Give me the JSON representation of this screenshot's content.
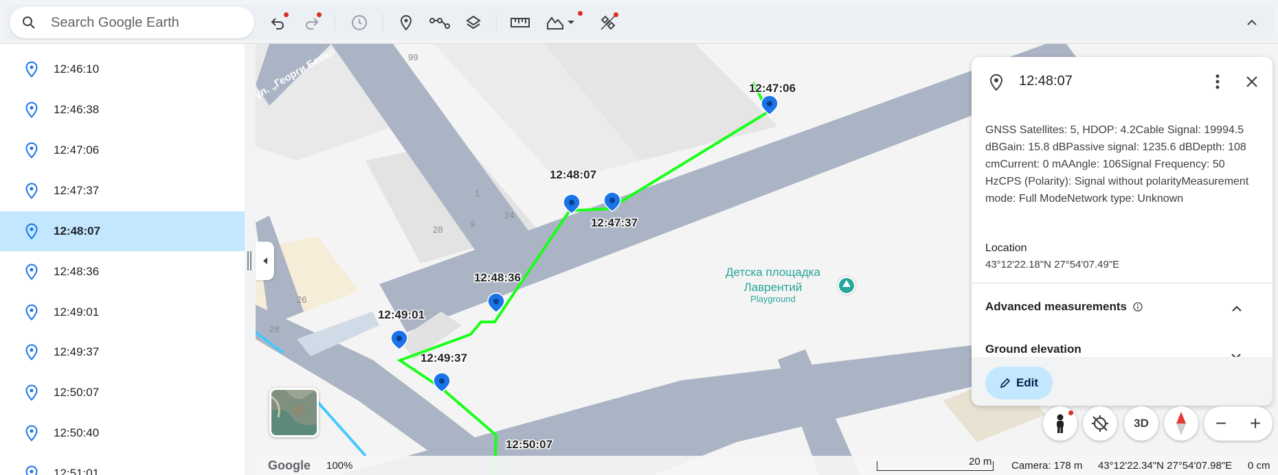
{
  "search": {
    "placeholder": "Search Google Earth"
  },
  "toolbar": {
    "icons": [
      "undo-icon",
      "redo-icon",
      "history-icon",
      "placemark-icon",
      "path-icon",
      "layers-icon",
      "ruler-icon",
      "elevation-icon",
      "satellite-icon",
      "collapse-icon"
    ]
  },
  "sidebar": {
    "items": [
      {
        "label": "12:46:10"
      },
      {
        "label": "12:46:38"
      },
      {
        "label": "12:47:06"
      },
      {
        "label": "12:47:37"
      },
      {
        "label": "12:48:07",
        "selected": true
      },
      {
        "label": "12:48:36"
      },
      {
        "label": "12:49:01"
      },
      {
        "label": "12:49:37"
      },
      {
        "label": "12:50:07"
      },
      {
        "label": "12:50:40"
      },
      {
        "label": "12:51:01"
      }
    ]
  },
  "map": {
    "street_label": "ул. „Георги Бенко",
    "building_numbers": [
      "99",
      "1",
      "24",
      "9",
      "28",
      "26",
      "28"
    ],
    "poi": {
      "name_line1": "Детска площадка",
      "name_line2": "Лаврентий",
      "subtitle": "Playground"
    },
    "markers": [
      {
        "label": "12:47:06"
      },
      {
        "label": "12:48:07"
      },
      {
        "label": "12:47:37"
      },
      {
        "label": "12:48:36"
      },
      {
        "label": "12:49:01"
      },
      {
        "label": "12:49:37"
      },
      {
        "label": "12:50:07"
      }
    ],
    "track_color": "#1aff1a",
    "marker_color": "#1a73e8"
  },
  "panel": {
    "title": "12:48:07",
    "description": "GNSS Satellites: 5, HDOP: 4.2Cable Signal: 19994.5 dBGain: 15.8 dBPassive signal: 1235.6 dBDepth: 108 cmCurrent: 0 mAAngle: 106Signal Frequency: 50 HzCPS (Polarity): Signal without polarityMeasurement mode: Full ModeNetwork type: Unknown",
    "location_label": "Location",
    "location_value": "43°12'22.18\"N 27°54'07.49\"E",
    "advanced_label": "Advanced measurements",
    "ground_label": "Ground elevation",
    "edit_label": "Edit"
  },
  "controls": {
    "three_d_label": "3D",
    "zoom_out": "−",
    "zoom_in": "+"
  },
  "status": {
    "google": "Google",
    "zoom": "100%",
    "scale": "20 m",
    "camera": "Camera: 178 m",
    "coords": "43°12'22.34\"N 27°54'07.98\"E",
    "elevation": "0 cm"
  }
}
